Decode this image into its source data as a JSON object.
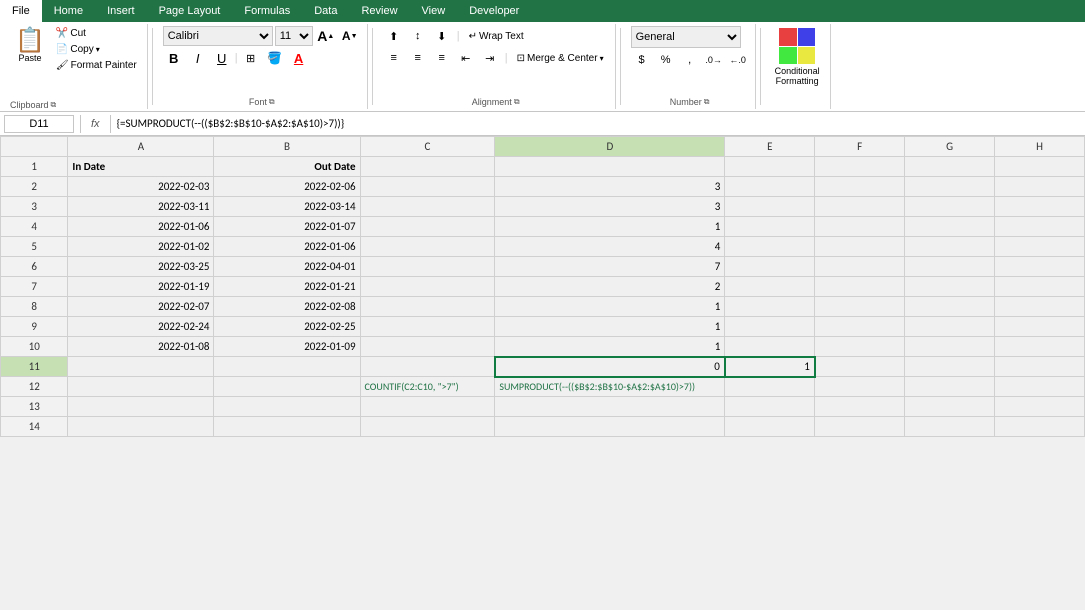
{
  "tabs": {
    "file": "File",
    "home": "Home",
    "insert": "Insert",
    "page_layout": "Page Layout",
    "formulas": "Formulas",
    "data": "Data",
    "review": "Review",
    "view": "View",
    "developer": "Developer"
  },
  "ribbon": {
    "clipboard": {
      "label": "Clipboard",
      "paste": "Paste",
      "cut": "Cut",
      "copy": "Copy",
      "format_painter": "Format Painter"
    },
    "font": {
      "label": "Font",
      "font_name": "Calibri",
      "font_size": "11",
      "bold": "B",
      "italic": "I",
      "underline": "U",
      "increase_font": "A",
      "decrease_font": "A"
    },
    "alignment": {
      "label": "Alignment",
      "wrap_text": "Wrap Text",
      "merge_center": "Merge & Center"
    },
    "number": {
      "label": "Number",
      "format": "General"
    }
  },
  "formula_bar": {
    "cell_ref": "D11",
    "fx": "fx",
    "formula": "{=SUMPRODUCT(--(($B$2:$B$10-$A$2:$A$10)>7))}"
  },
  "columns": [
    "A",
    "B",
    "C",
    "D",
    "E",
    "F",
    "G",
    "H"
  ],
  "rows": [
    {
      "num": 1,
      "A": "In Date",
      "B": "Out Date",
      "C": "",
      "D": "",
      "E": "",
      "F": "",
      "G": "",
      "H": ""
    },
    {
      "num": 2,
      "A": "2022-02-03",
      "B": "2022-02-06",
      "C": "",
      "D": "3",
      "E": "",
      "F": "",
      "G": "",
      "H": ""
    },
    {
      "num": 3,
      "A": "2022-03-11",
      "B": "2022-03-14",
      "C": "",
      "D": "3",
      "E": "",
      "F": "",
      "G": "",
      "H": ""
    },
    {
      "num": 4,
      "A": "2022-01-06",
      "B": "2022-01-07",
      "C": "",
      "D": "1",
      "E": "",
      "F": "",
      "G": "",
      "H": ""
    },
    {
      "num": 5,
      "A": "2022-01-02",
      "B": "2022-01-06",
      "C": "",
      "D": "4",
      "E": "",
      "F": "",
      "G": "",
      "H": ""
    },
    {
      "num": 6,
      "A": "2022-03-25",
      "B": "2022-04-01",
      "C": "",
      "D": "7",
      "E": "",
      "F": "",
      "G": "",
      "H": ""
    },
    {
      "num": 7,
      "A": "2022-01-19",
      "B": "2022-01-21",
      "C": "",
      "D": "2",
      "E": "",
      "F": "",
      "G": "",
      "H": ""
    },
    {
      "num": 8,
      "A": "2022-02-07",
      "B": "2022-02-08",
      "C": "",
      "D": "1",
      "E": "",
      "F": "",
      "G": "",
      "H": ""
    },
    {
      "num": 9,
      "A": "2022-02-24",
      "B": "2022-02-25",
      "C": "",
      "D": "1",
      "E": "",
      "F": "",
      "G": "",
      "H": ""
    },
    {
      "num": 10,
      "A": "2022-01-08",
      "B": "2022-01-09",
      "C": "",
      "D": "1",
      "E": "",
      "F": "",
      "G": "",
      "H": ""
    },
    {
      "num": 11,
      "A": "",
      "B": "",
      "C": "",
      "D": "0",
      "E": "1",
      "F": "",
      "G": "",
      "H": ""
    },
    {
      "num": 12,
      "A": "",
      "B": "",
      "C": "COUNTIF(C2:C10, \">7\")",
      "D": "SUMPRODUCT(--(($B$2:$B$10-$A$2:$A$10)>7))",
      "E": "",
      "F": "",
      "G": "",
      "H": ""
    },
    {
      "num": 13,
      "A": "",
      "B": "",
      "C": "",
      "D": "",
      "E": "",
      "F": "",
      "G": "",
      "H": ""
    },
    {
      "num": 14,
      "A": "",
      "B": "",
      "C": "",
      "D": "",
      "E": "",
      "F": "",
      "G": "",
      "H": ""
    }
  ]
}
